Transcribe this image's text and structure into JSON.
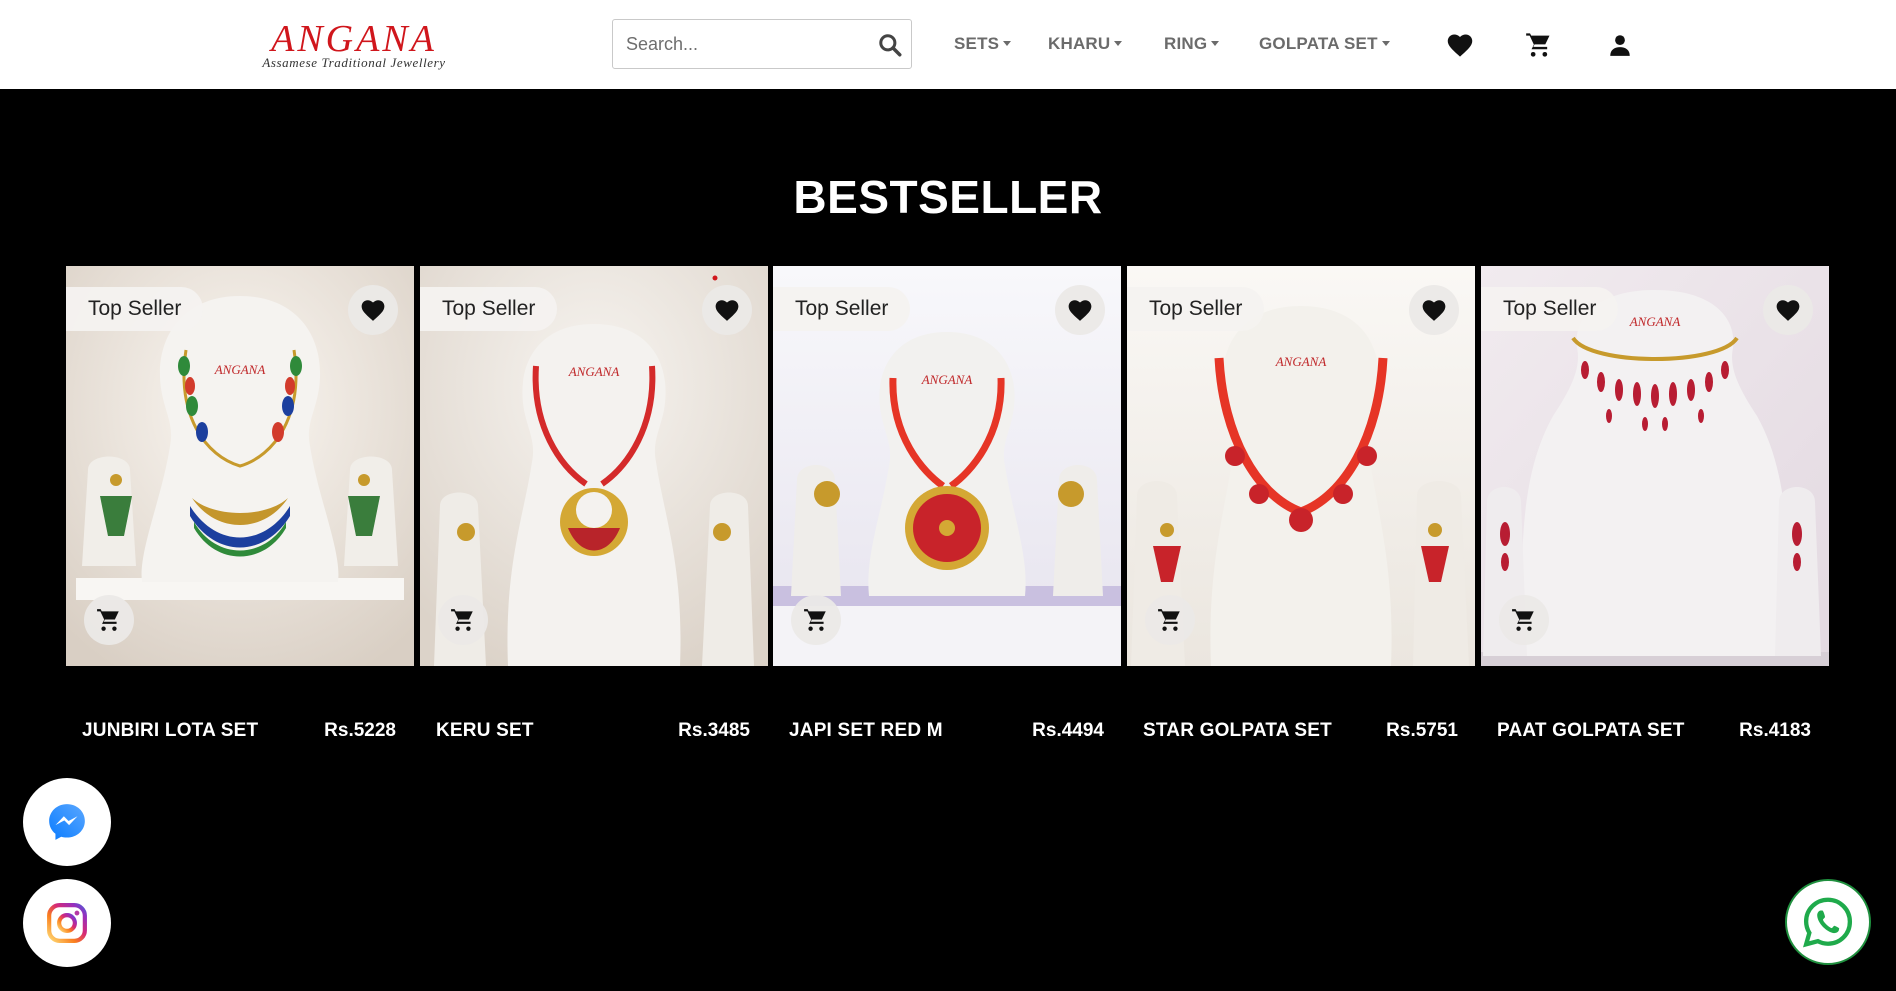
{
  "brand": {
    "name": "ANGANA",
    "tagline": "Assamese Traditional Jewellery"
  },
  "search": {
    "placeholder": "Search..."
  },
  "nav": [
    {
      "label": "SETS"
    },
    {
      "label": "KHARU"
    },
    {
      "label": "RING"
    },
    {
      "label": "GOLPATA SET"
    }
  ],
  "header_icons": [
    "heart-icon",
    "cart-icon",
    "user-icon"
  ],
  "section": {
    "title": "BESTSELLER"
  },
  "products": [
    {
      "badge": "Top Seller",
      "name": "JUNBIRI LOTA SET",
      "price": "Rs.5228"
    },
    {
      "badge": "Top Seller",
      "name": "KERU SET",
      "price": "Rs.3485"
    },
    {
      "badge": "Top Seller",
      "name": "JAPI SET RED M",
      "price": "Rs.4494"
    },
    {
      "badge": "Top Seller",
      "name": "STAR GOLPATA SET",
      "price": "Rs.5751"
    },
    {
      "badge": "Top Seller",
      "name": "PAAT GOLPATA SET",
      "price": "Rs.4183"
    }
  ],
  "floating": [
    "messenger-icon",
    "instagram-icon",
    "whatsapp-icon"
  ],
  "colors": {
    "brand_red": "#d0161c",
    "nav_gray": "#6b6b6b",
    "background": "#000000",
    "whatsapp_green": "#25d366"
  }
}
